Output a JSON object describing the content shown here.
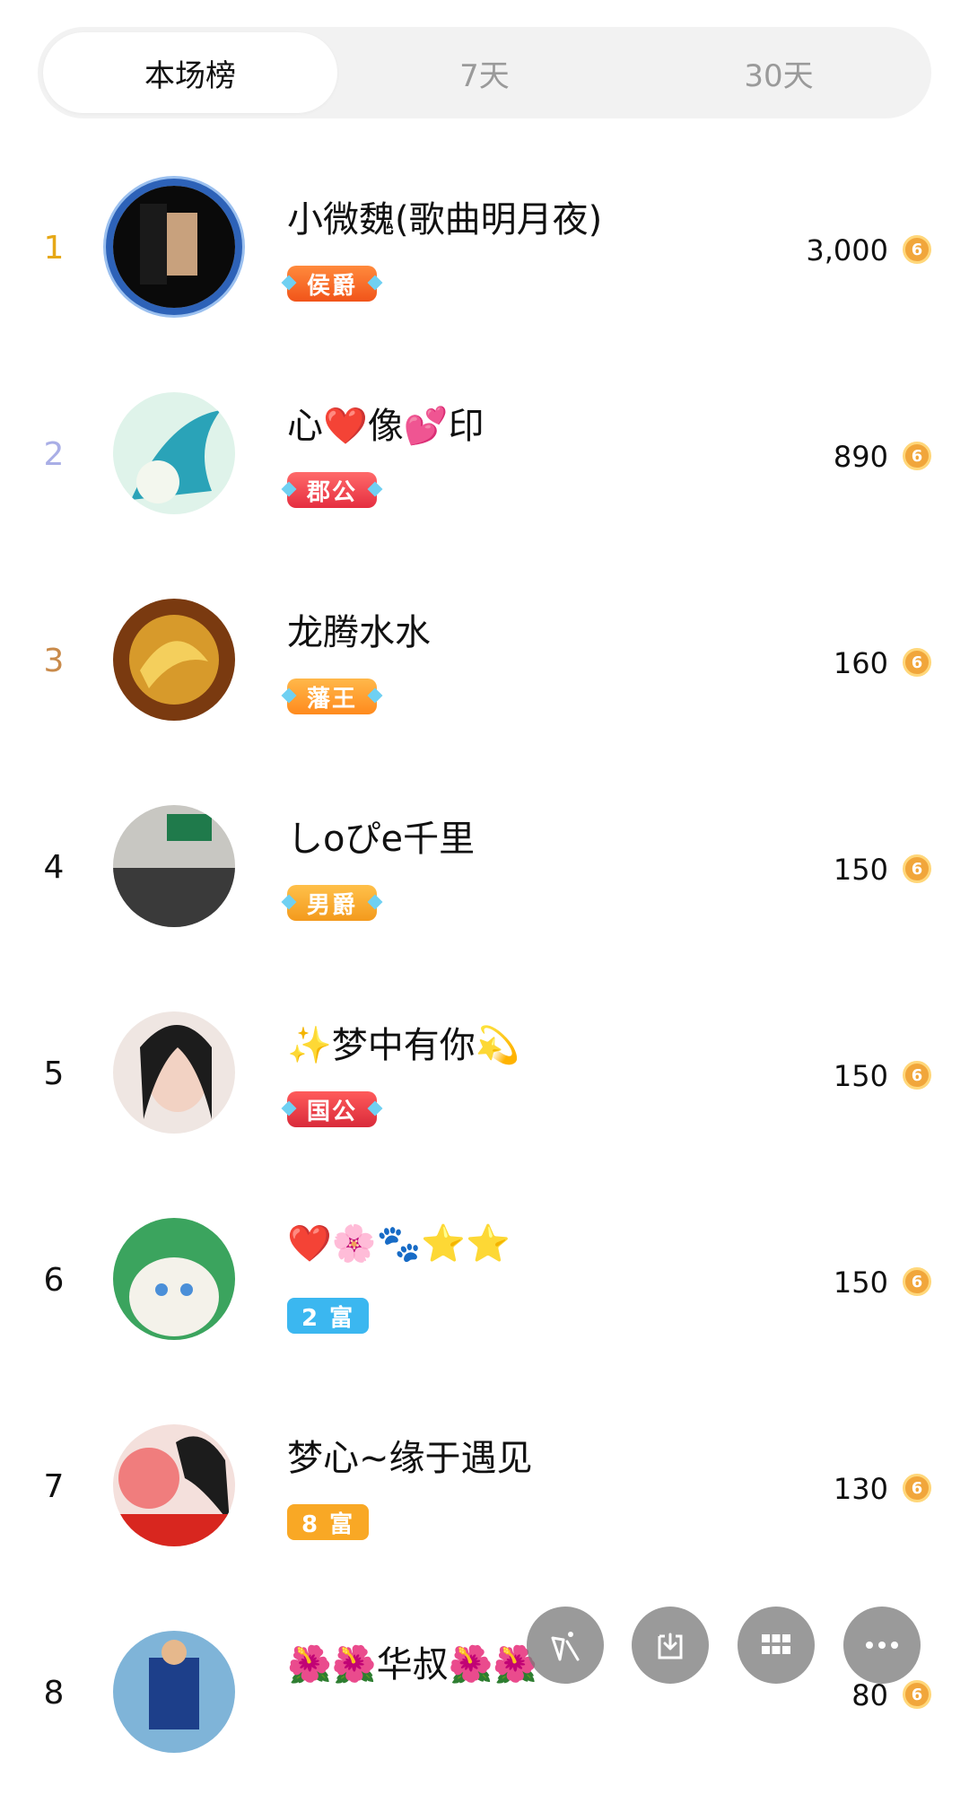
{
  "tabs": [
    {
      "label": "本场榜",
      "active": true
    },
    {
      "label": "7天",
      "active": false
    },
    {
      "label": "30天",
      "active": false
    }
  ],
  "rows": [
    {
      "rank": "1",
      "name": "小微魏(歌曲明月夜)",
      "badge": "侯爵",
      "amount": "3,000"
    },
    {
      "rank": "2",
      "name": "心❤️像💕印",
      "badge": "郡公",
      "amount": "890"
    },
    {
      "rank": "3",
      "name": "龙腾水水",
      "badge": "藩王",
      "amount": "160"
    },
    {
      "rank": "4",
      "name": "しoぴe千里",
      "badge": "男爵",
      "amount": "150"
    },
    {
      "rank": "5",
      "name": "✨梦中有你💫",
      "badge": "国公",
      "amount": "150"
    },
    {
      "rank": "6",
      "name": "❤️🌸🐾⭐⭐",
      "badge": "2 富",
      "amount": "150"
    },
    {
      "rank": "7",
      "name": "梦心~缘于遇见",
      "badge": "8 富",
      "amount": "130"
    },
    {
      "rank": "8",
      "name": "🌺🌺华叔🌺🌺",
      "badge": "",
      "amount": "80"
    }
  ],
  "colors": {
    "rank_1": "#e6a817",
    "rank_2": "#a9aee6",
    "rank_3": "#c98a4a",
    "rank_default": "#111111",
    "coin": "#f1a63b"
  },
  "fabs": [
    "share-icon",
    "download-icon",
    "grid-icon",
    "more-icon"
  ]
}
